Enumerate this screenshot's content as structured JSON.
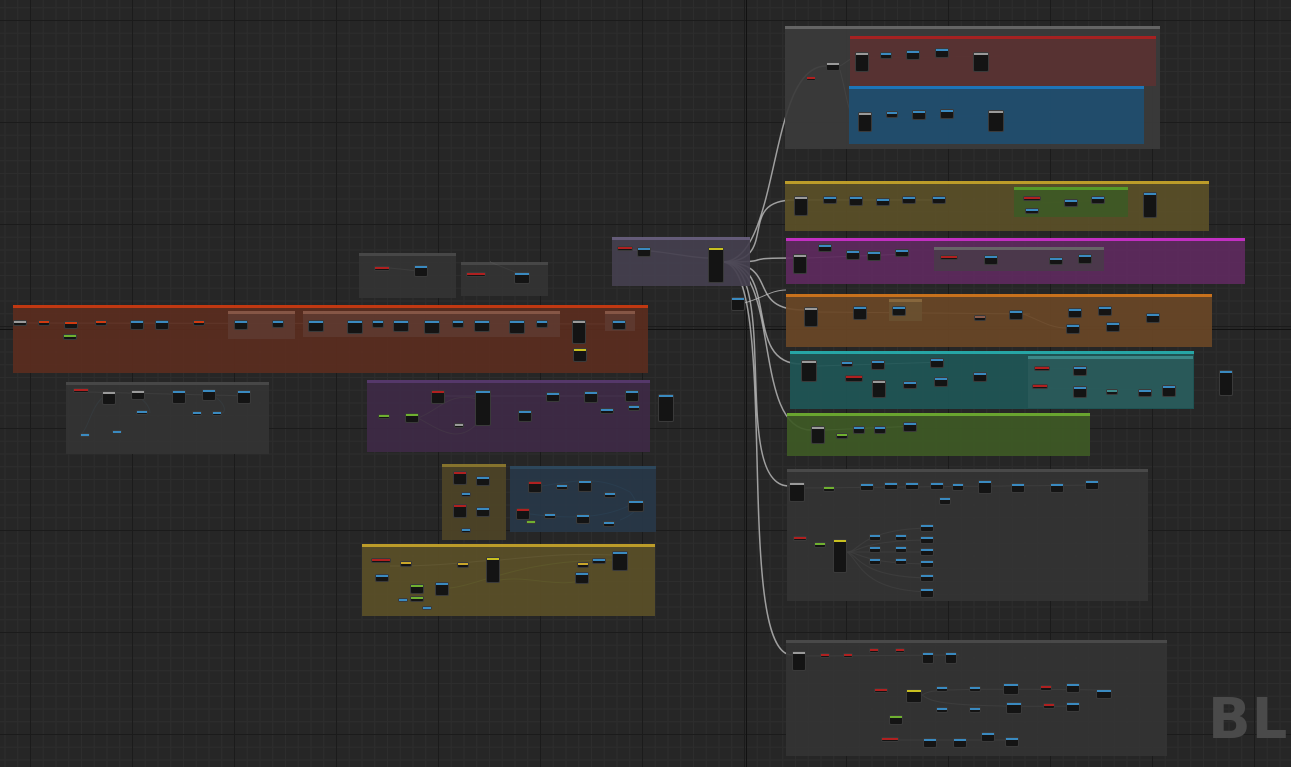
{
  "editor": {
    "watermark": "BLU",
    "colors": {
      "background": "#262626",
      "grid_major": "#1b1b1b",
      "grid_minor": "#2d2d2d",
      "exec_wire": "#c8c8c8",
      "float_wire": "#8fd94e",
      "object_wire": "#3fa0d8"
    }
  }
}
